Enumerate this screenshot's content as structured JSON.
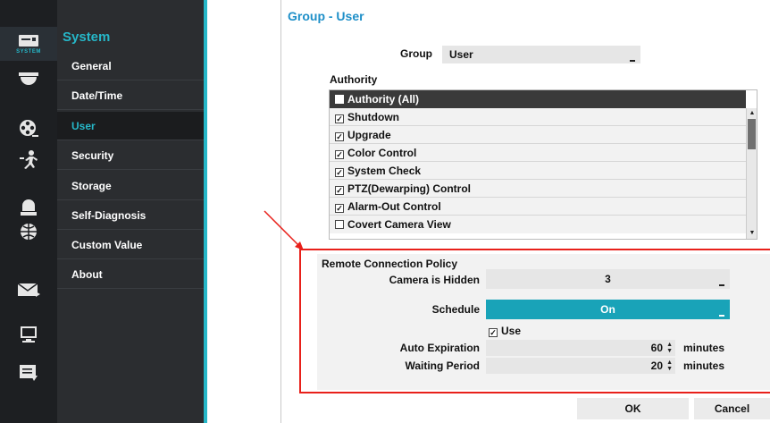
{
  "rail": {
    "items": [
      {
        "icon": "monitor-settings-icon",
        "caption": "SYSTEM",
        "active": true
      },
      {
        "icon": "dome-camera-icon"
      },
      {
        "icon": "film-reel-icon"
      },
      {
        "icon": "motion-person-icon"
      },
      {
        "icon": "alarm-bell-icon"
      },
      {
        "icon": "network-globe-icon"
      },
      {
        "icon": "mail-icon"
      },
      {
        "icon": "display-icon"
      },
      {
        "icon": "notes-icon"
      }
    ]
  },
  "menu": {
    "title": "System",
    "items": [
      "General",
      "Date/Time",
      "User",
      "Security",
      "Storage",
      "Self-Diagnosis",
      "Custom Value",
      "About"
    ],
    "active_index": 2
  },
  "dialog": {
    "title": "Group - User",
    "group_label": "Group",
    "group_value": "User",
    "authority_label": "Authority",
    "authority_header": "Authority (All)",
    "authority_items": [
      {
        "label": "Shutdown",
        "checked": true
      },
      {
        "label": "Upgrade",
        "checked": true
      },
      {
        "label": "Color Control",
        "checked": true
      },
      {
        "label": "System Check",
        "checked": true
      },
      {
        "label": "PTZ(Dewarping) Control",
        "checked": true
      },
      {
        "label": "Alarm-Out Control",
        "checked": true
      },
      {
        "label": "Covert Camera View",
        "checked": false
      }
    ],
    "policy": {
      "title": "Remote Connection Policy",
      "camera_hidden_label": "Camera is Hidden",
      "camera_hidden_value": "3",
      "schedule_label": "Schedule",
      "schedule_value": "On",
      "use_label": "Use",
      "use_checked": true,
      "auto_expiration_label": "Auto Expiration",
      "auto_expiration_value": "60",
      "waiting_period_label": "Waiting Period",
      "waiting_period_value": "20",
      "unit": "minutes"
    },
    "ok_label": "OK",
    "cancel_label": "Cancel"
  },
  "colors": {
    "accent": "#26b7c8",
    "title_blue": "#1e8fc8",
    "highlight_red": "#e8201a"
  }
}
